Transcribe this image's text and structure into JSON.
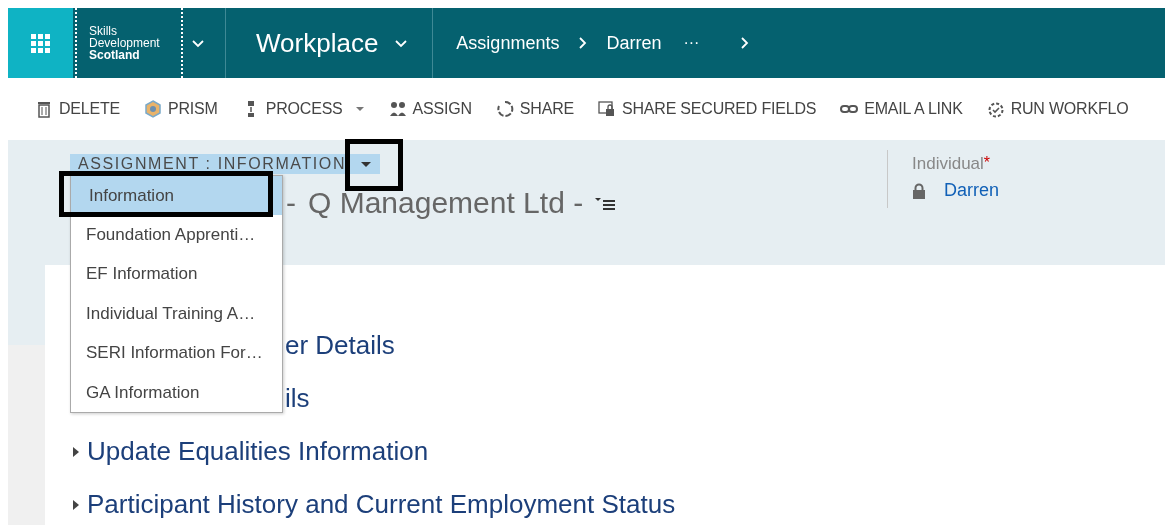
{
  "app_bar": {
    "brand": [
      "Skills",
      "Development",
      "Scotland"
    ],
    "app": "Workplace",
    "breadcrumbs": [
      "Assignments",
      "Darren"
    ],
    "more": "···"
  },
  "commands": [
    {
      "label": "DELETE",
      "has_menu": false
    },
    {
      "label": "PRISM",
      "has_menu": false
    },
    {
      "label": "PROCESS",
      "has_menu": true
    },
    {
      "label": "ASSIGN",
      "has_menu": false
    },
    {
      "label": "SHARE",
      "has_menu": false
    },
    {
      "label": "SHARE SECURED FIELDS",
      "has_menu": false
    },
    {
      "label": "EMAIL A LINK",
      "has_menu": false
    },
    {
      "label": "RUN WORKFLO",
      "has_menu": false
    }
  ],
  "form_selector": {
    "label": "ASSIGNMENT : INFORMATION",
    "expanded": true,
    "items": [
      {
        "label": "Information",
        "selected": true
      },
      {
        "label": "Foundation Apprenti…",
        "selected": false
      },
      {
        "label": "EF Information",
        "selected": false
      },
      {
        "label": "Individual Training A…",
        "selected": false
      },
      {
        "label": "SERI Information For…",
        "selected": false
      },
      {
        "label": "GA Information",
        "selected": false
      }
    ]
  },
  "record_title": [
    "-",
    "Q Management Ltd -"
  ],
  "header_field": {
    "label": "Individual",
    "required": true,
    "required_mark": "*",
    "value": "Darren",
    "locked": true
  },
  "sections": [
    {
      "kind": "covered",
      "title": "er Details"
    },
    {
      "kind": "covered",
      "title": "ils"
    },
    {
      "kind": "section",
      "title": "Update Equalities Information"
    },
    {
      "kind": "section",
      "title": "Participant History and Current Employment Status"
    }
  ]
}
